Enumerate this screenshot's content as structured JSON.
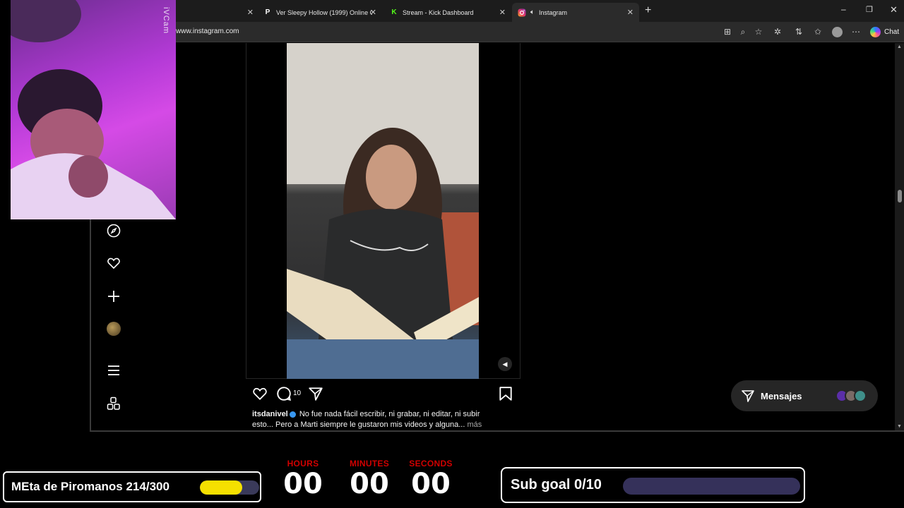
{
  "browser": {
    "tabs": [
      {
        "title": "Ver Sleepy Hollow (1999) Online G",
        "favicon": "P",
        "active": false
      },
      {
        "title": "Stream - Kick Dashboard",
        "favicon": "K",
        "active": false
      },
      {
        "title": "Instagram",
        "favicon": "instagram",
        "active": true
      }
    ],
    "url": "www.instagram.com",
    "chat_label": "Chat"
  },
  "webcam": {
    "label": "iVCam"
  },
  "post": {
    "comment_count": "10",
    "username": "itsdanivel",
    "caption": "No fue nada fácil escribir, ni grabar, ni editar, ni subir esto... Pero a Marti siempre le gustaron mis videos y alguna...",
    "more_label": "más"
  },
  "messages": {
    "label": "Mensajes"
  },
  "overlay": {
    "left_goal": {
      "text": "MEta de Piromanos 214/300",
      "progress": 0.713,
      "fill_color": "#f5e000"
    },
    "right_goal": {
      "text": "Sub goal 0/10",
      "progress": 0.0
    },
    "timer": {
      "hours_label": "HOURS",
      "hours": "00",
      "minutes_label": "MINUTES",
      "minutes": "00",
      "seconds_label": "SECONDS",
      "seconds": "00"
    }
  },
  "colors": {
    "timer_label": "#d10000",
    "verified_badge": "#3897f0",
    "kick_green": "#53fc18"
  }
}
